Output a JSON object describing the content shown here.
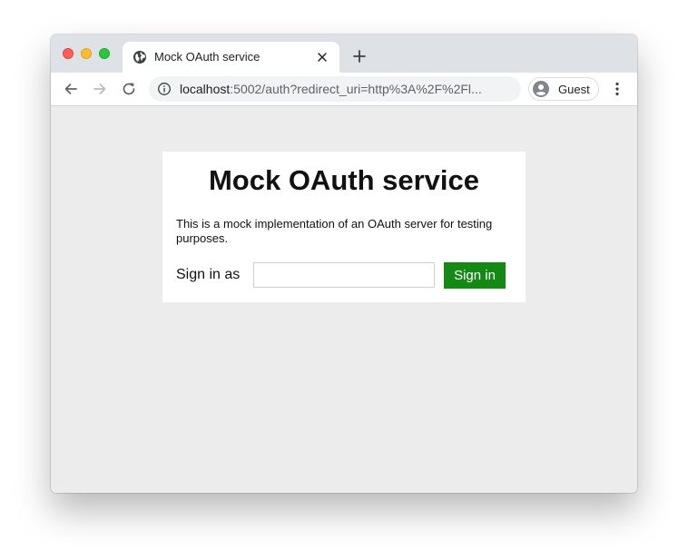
{
  "browser": {
    "tab": {
      "title": "Mock OAuth service",
      "favicon": "globe-icon"
    },
    "address_bar": {
      "host": "localhost",
      "path": ":5002/auth?redirect_uri=http%3A%2F%2Fl..."
    },
    "profile": {
      "label": "Guest"
    },
    "icons": {
      "back": "back-arrow-icon",
      "forward": "forward-arrow-icon",
      "reload": "reload-icon",
      "info": "info-icon",
      "new_tab": "plus-icon",
      "close_tab": "close-icon",
      "menu": "more-vertical-icon",
      "avatar": "person-icon"
    }
  },
  "page": {
    "title": "Mock OAuth service",
    "description": "This is a mock implementation of an OAuth server for testing purposes.",
    "signin_label": "Sign in as",
    "input_value": "",
    "input_placeholder": "",
    "signin_button": "Sign in"
  },
  "colors": {
    "signin_button": "#148914",
    "page_background": "#ececec",
    "card_background": "#ffffff",
    "titlebar": "#dee1e6"
  }
}
